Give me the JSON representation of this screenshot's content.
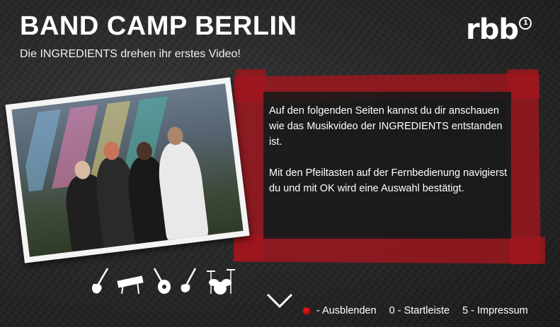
{
  "header": {
    "title": "BAND CAMP BERLIN",
    "subtitle": "Die INGREDIENTS drehen ihr erstes Video!",
    "logo_text": "rbb",
    "logo_badge": "1"
  },
  "content": {
    "paragraph_1": "Auf den folgenden Seiten kannst du dir anschauen wie das Musikvideo der INGREDIENTS entstanden ist.",
    "paragraph_2": "Mit den Pfeiltasten auf der Fernbedienung navigierst du und mit OK wird eine Auswahl bestätigt."
  },
  "icons": [
    "electric-guitar-icon",
    "keyboard-icon",
    "acoustic-guitar-icon",
    "bass-guitar-icon",
    "drum-kit-icon"
  ],
  "footer": {
    "hide_label": "- Ausblenden",
    "start_label": "0 - Startleiste",
    "impressum_label": "5 - Impressum"
  },
  "colors": {
    "tape_red": "#a0161e",
    "button_red": "#e01414",
    "text": "#ffffff"
  }
}
